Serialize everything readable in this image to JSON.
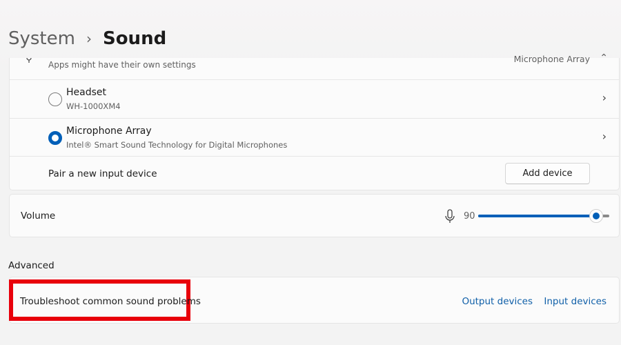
{
  "breadcrumb": {
    "parent": "System",
    "separator": "›",
    "current": "Sound"
  },
  "input_section": {
    "note": "Apps might have their own settings",
    "selected_summary": "Microphone Array",
    "devices": [
      {
        "name": "Headset",
        "description": "WH-1000XM4",
        "selected": false
      },
      {
        "name": "Microphone Array",
        "description": "Intel® Smart Sound Technology for Digital Microphones",
        "selected": true
      }
    ],
    "pair_label": "Pair a new input device",
    "add_button": "Add device"
  },
  "volume": {
    "label": "Volume",
    "value": "90",
    "level_percent": 90
  },
  "advanced": {
    "title": "Advanced",
    "troubleshoot": "Troubleshoot common sound problems",
    "output_link": "Output devices",
    "input_link": "Input devices"
  },
  "colors": {
    "accent": "#005fb8",
    "highlight": "#e8000b",
    "link": "#0f5fa8"
  }
}
